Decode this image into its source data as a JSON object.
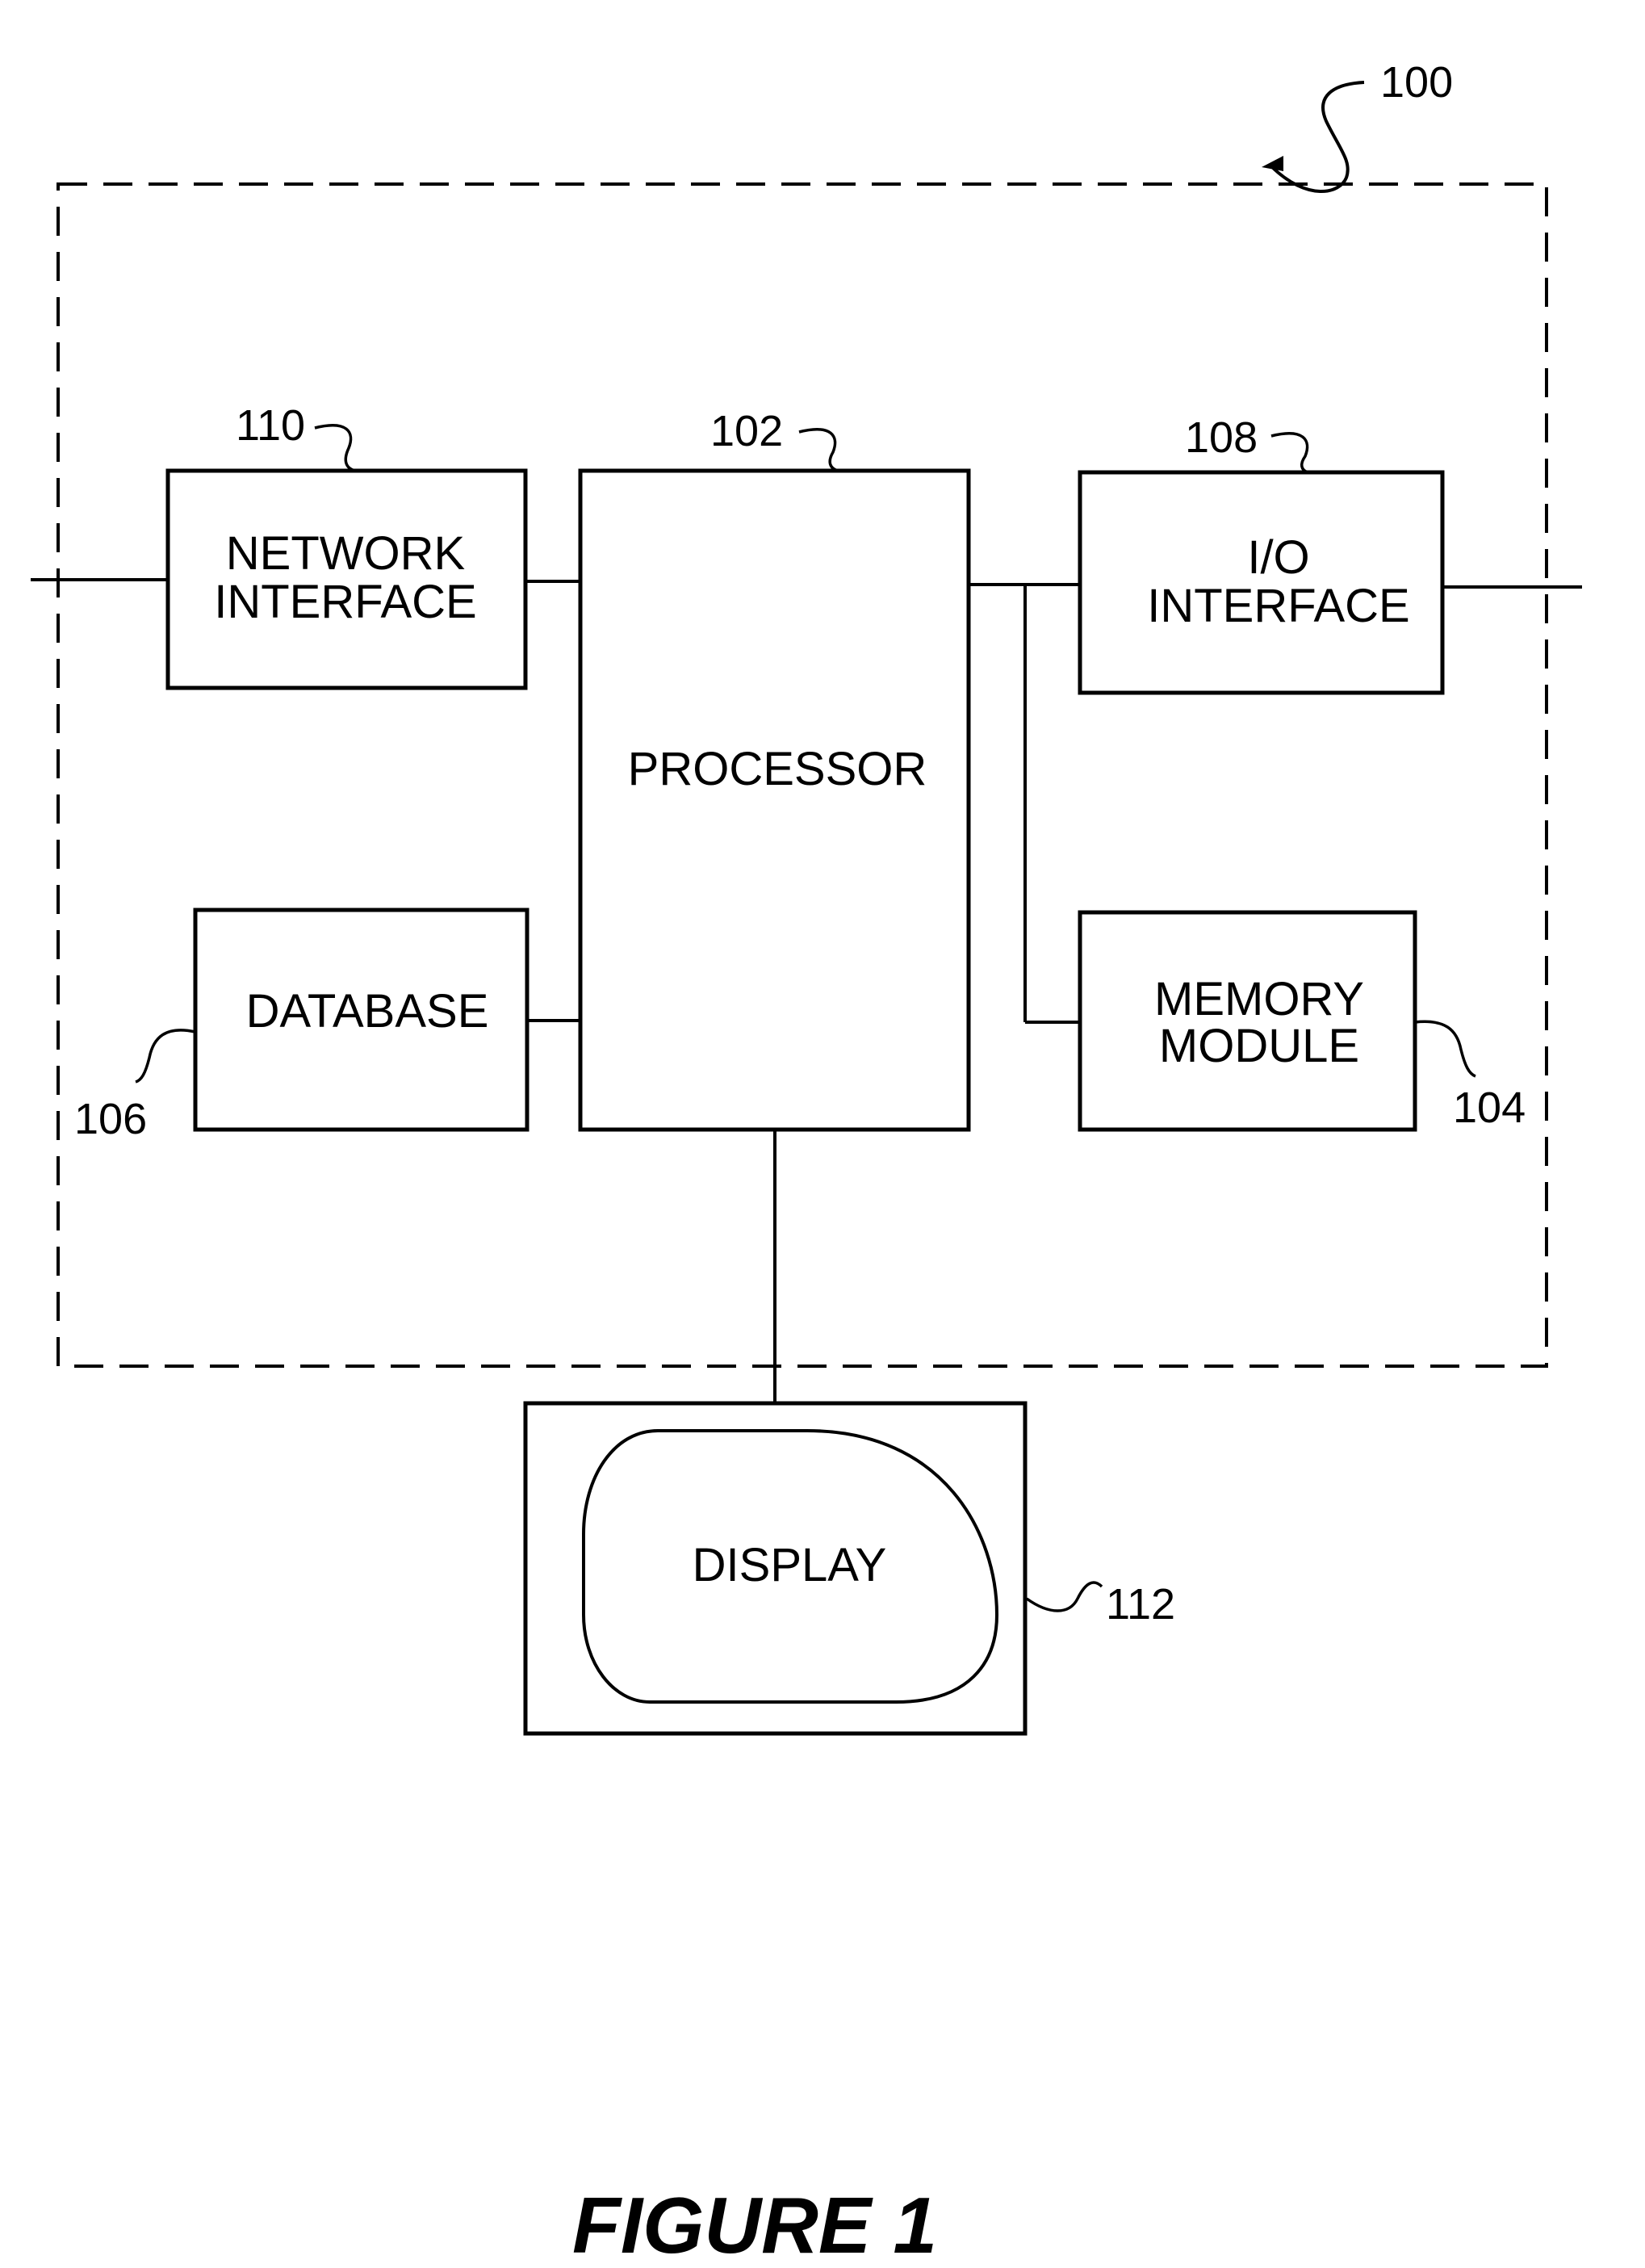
{
  "figure": {
    "caption": "FIGURE 1",
    "system_ref": "100",
    "blocks": {
      "network_interface": {
        "ref": "110",
        "lines": [
          "NETWORK",
          "INTERFACE"
        ]
      },
      "processor": {
        "ref": "102",
        "lines": [
          "PROCESSOR"
        ]
      },
      "io_interface": {
        "ref": "108",
        "lines": [
          "I/O",
          "INTERFACE"
        ]
      },
      "database": {
        "ref": "106",
        "lines": [
          "DATABASE"
        ]
      },
      "memory_module": {
        "ref": "104",
        "lines": [
          "MEMORY",
          "MODULE"
        ]
      },
      "display": {
        "ref": "112",
        "lines": [
          "DISPLAY"
        ]
      }
    }
  }
}
